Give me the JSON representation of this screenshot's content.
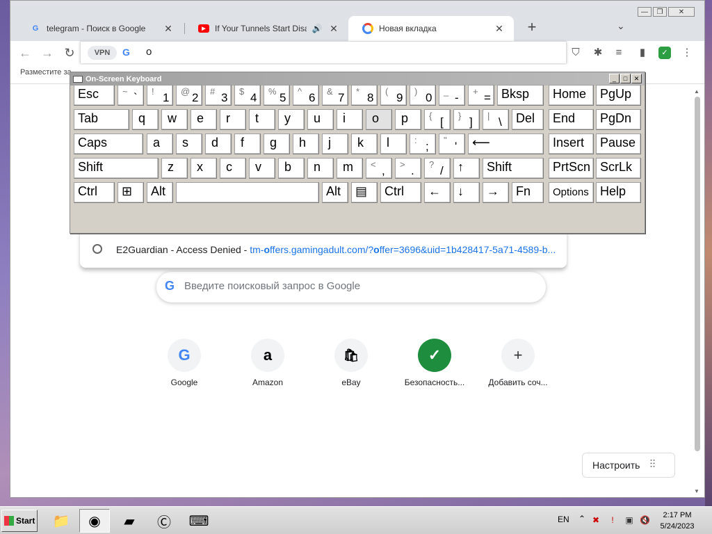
{
  "window": {
    "tabs": [
      {
        "title": "telegram - Поиск в Google",
        "icon": "google-g-icon"
      },
      {
        "title": "If Your Tunnels Start Disappear",
        "icon": "youtube-icon"
      },
      {
        "title": "Новая вкладка",
        "icon": "chrome-icon"
      }
    ],
    "new_tab": "+",
    "tab_search": "⌄"
  },
  "toolbar": {
    "vpn_label": "VPN",
    "omnibox_text": "o",
    "bookmarks_text": "Разместите за"
  },
  "suggestion": {
    "title": "E2Guardian - Access Denied",
    "separator": " - ",
    "url_prefix": "tm-",
    "url_match": "o",
    "url_mid": "ffers.gamingadult.com/?",
    "url_match2": "o",
    "url_rest": "ffer=3696&uid=1b428417-5a71-4589-b..."
  },
  "ntp": {
    "search_placeholder": "Введите поисковый запрос в Google",
    "tiles": [
      {
        "label": "Google",
        "icon": "G"
      },
      {
        "label": "Amazon",
        "icon": "a"
      },
      {
        "label": "eBay",
        "icon": "🛍"
      },
      {
        "label": "Безопасность...",
        "icon": "✓"
      },
      {
        "label": "Добавить соч...",
        "icon": "+"
      }
    ],
    "customize_label": "Настроить"
  },
  "osk": {
    "title": "On-Screen Keyboard",
    "rows": [
      [
        {
          "label": "Esc"
        },
        {
          "shift": "~",
          "base": "`"
        },
        {
          "shift": "!",
          "base": "1"
        },
        {
          "shift": "@",
          "base": "2"
        },
        {
          "shift": "#",
          "base": "3"
        },
        {
          "shift": "$",
          "base": "4"
        },
        {
          "shift": "%",
          "base": "5"
        },
        {
          "shift": "^",
          "base": "6"
        },
        {
          "shift": "&",
          "base": "7"
        },
        {
          "shift": "*",
          "base": "8"
        },
        {
          "shift": "(",
          "base": "9"
        },
        {
          "shift": ")",
          "base": "0"
        },
        {
          "shift": "_",
          "base": "-"
        },
        {
          "shift": "+",
          "base": "="
        },
        {
          "label": "Bksp"
        },
        {
          "label": "Home"
        },
        {
          "label": "PgUp"
        }
      ],
      [
        {
          "label": "Tab"
        },
        {
          "label": "q"
        },
        {
          "label": "w"
        },
        {
          "label": "e"
        },
        {
          "label": "r"
        },
        {
          "label": "t"
        },
        {
          "label": "y"
        },
        {
          "label": "u"
        },
        {
          "label": "i"
        },
        {
          "label": "o"
        },
        {
          "label": "p"
        },
        {
          "shift": "{",
          "base": "["
        },
        {
          "shift": "}",
          "base": "]"
        },
        {
          "shift": "|",
          "base": "\\"
        },
        {
          "label": "Del"
        },
        {
          "label": "End"
        },
        {
          "label": "PgDn"
        }
      ],
      [
        {
          "label": "Caps"
        },
        {
          "label": "a"
        },
        {
          "label": "s"
        },
        {
          "label": "d"
        },
        {
          "label": "f"
        },
        {
          "label": "g"
        },
        {
          "label": "h"
        },
        {
          "label": "j"
        },
        {
          "label": "k"
        },
        {
          "label": "l"
        },
        {
          "shift": ":",
          "base": ";"
        },
        {
          "shift": "\"",
          "base": "'"
        },
        {
          "label": "⟵"
        },
        {
          "label": "Insert"
        },
        {
          "label": "Pause"
        }
      ],
      [
        {
          "label": "Shift"
        },
        {
          "label": "z"
        },
        {
          "label": "x"
        },
        {
          "label": "c"
        },
        {
          "label": "v"
        },
        {
          "label": "b"
        },
        {
          "label": "n"
        },
        {
          "label": "m"
        },
        {
          "shift": "<",
          "base": ","
        },
        {
          "shift": ">",
          "base": "."
        },
        {
          "shift": "?",
          "base": "/"
        },
        {
          "label": "↑"
        },
        {
          "label": "Shift"
        },
        {
          "label": "PrtScn"
        },
        {
          "label": "ScrLk"
        }
      ],
      [
        {
          "label": "Ctrl"
        },
        {
          "label": "⊞"
        },
        {
          "label": "Alt"
        },
        {
          "label": ""
        },
        {
          "label": "Alt"
        },
        {
          "label": "▤"
        },
        {
          "label": "Ctrl"
        },
        {
          "label": "←"
        },
        {
          "label": "↓"
        },
        {
          "label": "→"
        },
        {
          "label": "Fn"
        },
        {
          "label": "Options"
        },
        {
          "label": "Help"
        }
      ]
    ],
    "highlighted_key": "o"
  },
  "taskbar": {
    "start_label": "Start",
    "language": "EN",
    "time": "2:17 PM",
    "date": "5/24/2023"
  }
}
